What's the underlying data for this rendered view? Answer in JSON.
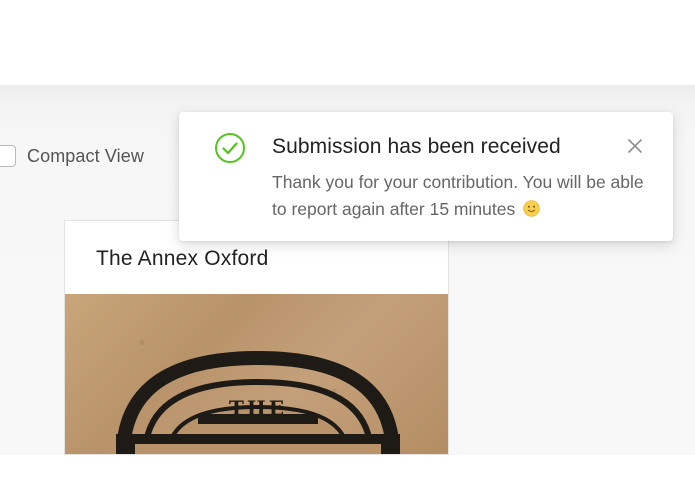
{
  "view_options": {
    "compact_view_label": "Compact View",
    "compact_view_checked": false
  },
  "card": {
    "title": "The Annex Oxford",
    "image_text": "THE"
  },
  "toast": {
    "title": "Submission has been received",
    "message": "Thank you for your contribution. You will be able to report again after 15 minutes",
    "status_icon": "check-circle-icon",
    "emoji_icon": "slightly-smiling-face-icon",
    "close_icon": "close-icon",
    "accent_color": "#52c41a"
  },
  "colors": {
    "page_background": "#f5f5f5",
    "card_border": "#e3e3e3",
    "success": "#52c41a"
  }
}
